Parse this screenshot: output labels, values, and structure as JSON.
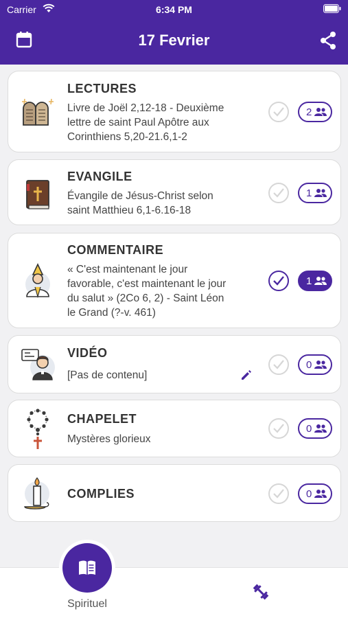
{
  "status": {
    "carrier": "Carrier",
    "time": "6:34 PM"
  },
  "topbar": {
    "title": "17 Fevrier"
  },
  "cards": [
    {
      "title": "LECTURES",
      "lines": [
        "Livre de Joël  2,12-18 - Deuxième",
        "lettre de saint Paul Apôtre aux",
        "Corinthiens  5,20-21.6,1-2"
      ],
      "icon": "tablets-icon",
      "done": false,
      "count": "2"
    },
    {
      "title": "EVANGILE",
      "lines": [
        "Évangile de Jésus-Christ selon",
        "saint Matthieu  6,1-6.16-18"
      ],
      "icon": "bible-icon",
      "done": false,
      "count": "1"
    },
    {
      "title": "COMMENTAIRE",
      "lines": [
        "« C'est maintenant le jour",
        "favorable, c'est maintenant le jour",
        "du salut » (2Co 6, 2) - Saint Léon",
        "le Grand (?-v. 461)"
      ],
      "icon": "pope-icon",
      "done": true,
      "count": "1"
    },
    {
      "title": "VIDÉO",
      "lines": [
        "[Pas de contenu]"
      ],
      "icon": "priest-video-icon",
      "done": false,
      "count": "0"
    },
    {
      "title": "CHAPELET",
      "lines": [
        "Mystères glorieux"
      ],
      "icon": "rosary-icon",
      "done": false,
      "count": "0"
    },
    {
      "title": "COMPLIES",
      "lines": [],
      "icon": "candle-icon",
      "done": false,
      "count": "0"
    }
  ],
  "bottom_nav": {
    "active_label": "Spirituel"
  },
  "colors": {
    "primary": "#4a27a0",
    "background": "#f1f1f3",
    "check_inactive": "#d6d6d6"
  }
}
